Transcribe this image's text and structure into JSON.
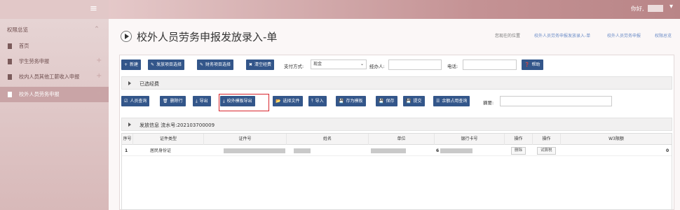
{
  "header": {
    "menu_icon": "hamburger-icon",
    "greeting": "你好,"
  },
  "sidebar": {
    "section_title": "权限总览",
    "collapse_icon": "caret-up-icon",
    "items": [
      {
        "label": "首页",
        "active": false
      },
      {
        "label": "学生劳务申报",
        "active": false
      },
      {
        "label": "校内人员其他工薪收入申报",
        "active": false
      },
      {
        "label": "校外人员劳务申报",
        "active": true
      }
    ]
  },
  "page": {
    "title": "校外人员劳务申报发放录入-单",
    "breadcrumb_label": "您现在的位置",
    "breadcrumbs": [
      "校外人员劳务申报发放录入-单",
      "校外人员劳务申报",
      "权限总览"
    ]
  },
  "toolbar1": {
    "new": "新建",
    "project_select": "发放项目选择",
    "finance_select": "财务项目选择",
    "clear": "清空经费",
    "pay_method_label": "支付方式:",
    "pay_method_value": "现金",
    "handler_label": "经办人:",
    "phone_label": "电话:",
    "help": "帮助"
  },
  "selected_funds": {
    "label": "已选经费"
  },
  "toolbar2": {
    "query": "人员查询",
    "delete_row": "删除行",
    "export": "导出",
    "export_template": "校外模板导出",
    "choose_file": "选择文件",
    "import": "导入",
    "save_template": "存为模板",
    "save": "保存",
    "submit": "提交",
    "quota_query": "余额占用查询",
    "summary_label": "摘要:"
  },
  "dispatch": {
    "label": "发放信息 流水号:202103700009"
  },
  "table": {
    "columns": [
      "序号",
      "证件类型",
      "证件号",
      "姓名",
      "单位",
      "银行卡号",
      "操作",
      "操作",
      "W3限额"
    ],
    "rows": [
      {
        "index": "1",
        "id_type": "居民身份证",
        "card_prefix": "6",
        "op1": "删除",
        "op2": "试算税",
        "limit": "0"
      }
    ]
  },
  "colors": {
    "button": "#33568a",
    "highlight": "#d8262e",
    "link": "#6b8cc7"
  }
}
